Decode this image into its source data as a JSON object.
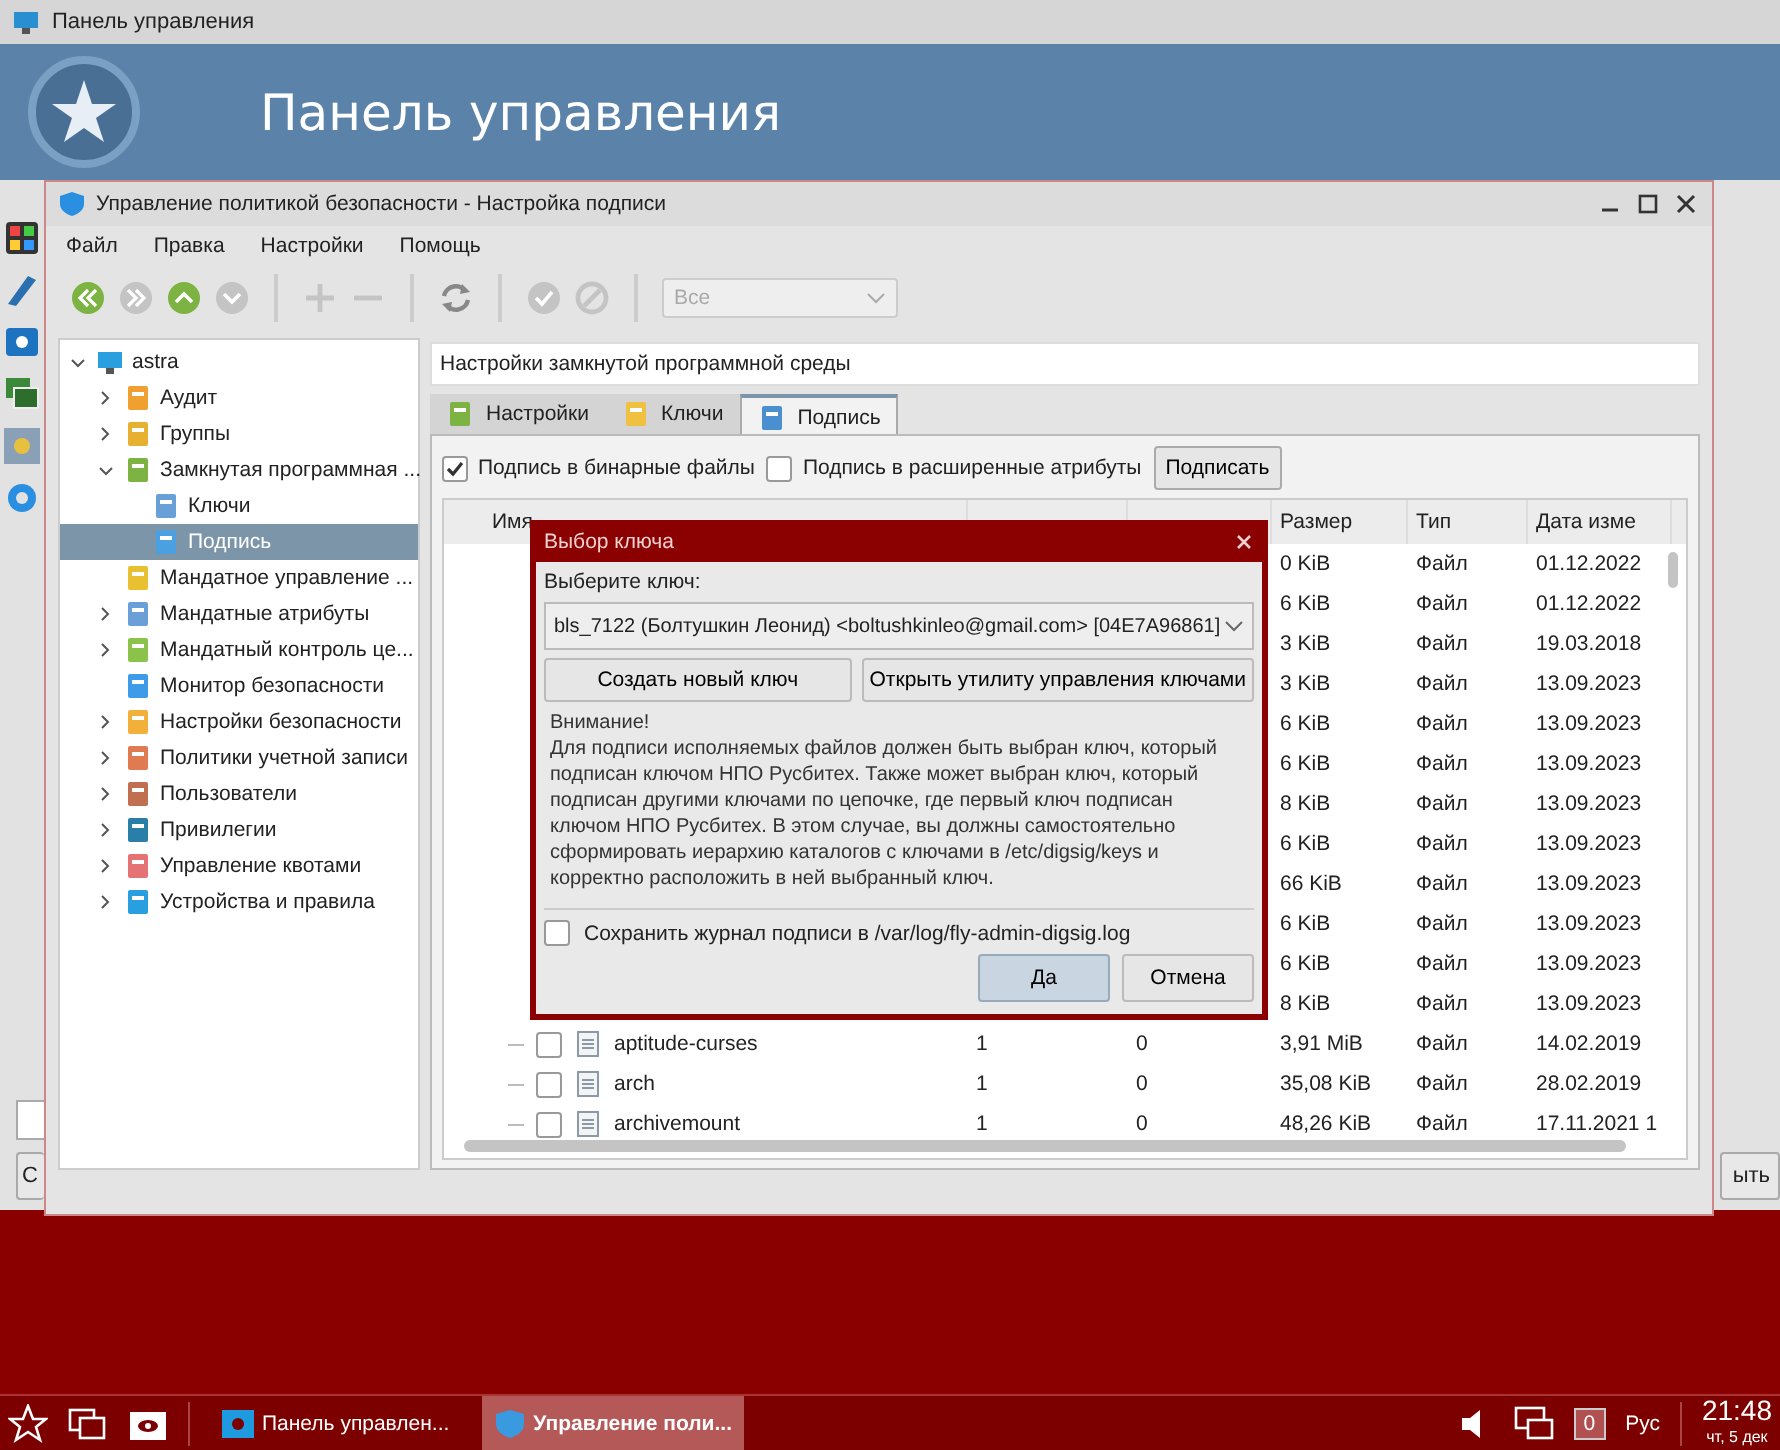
{
  "back_window": {
    "title": "Панель управления",
    "banner": "Панель управления",
    "left_button": "С",
    "right_button": "ыть"
  },
  "window": {
    "title": "Управление политикой безопасности - Настройка подписи"
  },
  "menu": [
    "Файл",
    "Правка",
    "Настройки",
    "Помощь"
  ],
  "toolbar": [
    {
      "kind": "back",
      "disabled": false
    },
    {
      "kind": "forward",
      "disabled": true
    },
    {
      "kind": "up",
      "disabled": false
    },
    {
      "kind": "down",
      "disabled": true
    },
    {
      "kind": "separator"
    },
    {
      "kind": "add",
      "disabled": true
    },
    {
      "kind": "remove",
      "disabled": true
    },
    {
      "kind": "separator"
    },
    {
      "kind": "refresh",
      "disabled": false
    },
    {
      "kind": "separator"
    },
    {
      "kind": "apply",
      "disabled": true
    },
    {
      "kind": "cancel",
      "disabled": true
    },
    {
      "kind": "separator"
    }
  ],
  "filter": {
    "value": "Все",
    "disabled": true
  },
  "tree": [
    {
      "label": "astra",
      "expanded": true,
      "selected": false,
      "children": [
        {
          "label": "Аудит",
          "expanded": false,
          "selected": false
        },
        {
          "label": "Группы",
          "expanded": false,
          "selected": false
        },
        {
          "label": "Замкнутая программная ...",
          "expanded": true,
          "selected": false,
          "children": [
            {
              "label": "Ключи",
              "selected": false
            },
            {
              "label": "Подпись",
              "selected": true
            }
          ]
        },
        {
          "label": "Мандатное управление ...",
          "selected": false
        },
        {
          "label": "Мандатные атрибуты",
          "expanded": false,
          "selected": false
        },
        {
          "label": "Мандатный контроль це...",
          "expanded": false,
          "selected": false
        },
        {
          "label": "Монитор безопасности",
          "selected": false
        },
        {
          "label": "Настройки безопасности",
          "expanded": false,
          "selected": false
        },
        {
          "label": "Политики учетной записи",
          "expanded": false,
          "selected": false
        },
        {
          "label": "Пользователи",
          "expanded": false,
          "selected": false
        },
        {
          "label": "Привилегии",
          "expanded": false,
          "selected": false
        },
        {
          "label": "Управление квотами",
          "expanded": false,
          "selected": false
        },
        {
          "label": "Устройства и правила",
          "expanded": false,
          "selected": false
        }
      ]
    }
  ],
  "section_title": "Настройки замкнутой программной среды",
  "tabs": [
    {
      "label": "Настройки",
      "selected": false
    },
    {
      "label": "Ключи",
      "selected": false
    },
    {
      "label": "Подпись",
      "selected": true
    }
  ],
  "options": [
    {
      "label": "Подпись в бинарные файлы",
      "checked": true
    },
    {
      "label": "Подпись в расширенные атрибуты",
      "checked": false
    }
  ],
  "sign_button": "Подписать",
  "table": {
    "columns": [
      "Имя",
      "Размер",
      "Тип",
      "Дата изме"
    ],
    "rows": [
      {
        "kind": "covered",
        "size": "0 KiB",
        "type": "Файл",
        "date": "01.12.2022"
      },
      {
        "kind": "covered",
        "size": "6 KiB",
        "type": "Файл",
        "date": "01.12.2022"
      },
      {
        "kind": "covered",
        "size": "3 KiB",
        "type": "Файл",
        "date": "19.03.2018"
      },
      {
        "kind": "covered",
        "size": "3 KiB",
        "type": "Файл",
        "date": "13.09.2023"
      },
      {
        "kind": "covered",
        "size": "6 KiB",
        "type": "Файл",
        "date": "13.09.2023"
      },
      {
        "kind": "covered",
        "size": "6 KiB",
        "type": "Файл",
        "date": "13.09.2023"
      },
      {
        "kind": "covered",
        "size": "8 KiB",
        "type": "Файл",
        "date": "13.09.2023"
      },
      {
        "kind": "covered",
        "size": "6 KiB",
        "type": "Файл",
        "date": "13.09.2023"
      },
      {
        "kind": "covered",
        "size": "66 KiB",
        "type": "Файл",
        "date": "13.09.2023"
      },
      {
        "kind": "covered",
        "size": "6 KiB",
        "type": "Файл",
        "date": "13.09.2023"
      },
      {
        "kind": "covered",
        "size": "6 KiB",
        "type": "Файл",
        "date": "13.09.2023"
      },
      {
        "kind": "covered",
        "size": "8 KiB",
        "type": "Файл",
        "date": "13.09.2023"
      },
      {
        "kind": "file",
        "name": "aptitude-curses",
        "checked": false,
        "signatures": "1",
        "extended": "0",
        "size": "3,91 MiB",
        "type": "Файл",
        "date": "14.02.2019"
      },
      {
        "kind": "file",
        "name": "arch",
        "checked": false,
        "signatures": "1",
        "extended": "0",
        "size": "35,08 KiB",
        "type": "Файл",
        "date": "28.02.2019"
      },
      {
        "kind": "file",
        "name": "archivemount",
        "checked": false,
        "signatures": "1",
        "extended": "0",
        "size": "48,26 KiB",
        "type": "Файл",
        "date": "17.11.2021 1"
      }
    ]
  },
  "dialog": {
    "title": "Выбор ключа",
    "key_label": "Выберите ключ:",
    "key": "bls_7122 (Болтушкин Леонид) <boltushkinleo@gmail.com> [04E7A96861]",
    "create_button": "Создать новый ключ",
    "open_button": "Открыть утилиту управления ключами",
    "warning_title": "Внимание!",
    "warning_text": "Для подписи исполняемых файлов должен быть выбран ключ, который подписан ключом НПО Русбитех. Также может выбран ключ, который подписан другими ключами по цепочке, где первый ключ подписан ключом НПО Русбитех. В этом случае, вы должны самостоятельно сформировать иерархию каталогов с ключами в /etc/digsig/keys и корректно расположить в ней выбранный ключ.",
    "log_option": {
      "label": "Сохранить журнал подписи в  /var/log/fly-admin-digsig.log",
      "checked": false
    },
    "ok_button": "Да",
    "cancel_button": "Отмена"
  },
  "taskbar": {
    "tasks": [
      {
        "label": "Панель управлен...",
        "selected": false
      },
      {
        "label": "Управление поли...",
        "selected": true
      }
    ],
    "keyboard_layout": "Рус",
    "notifications": "0",
    "time": "21:48",
    "date": "чт, 5 дек"
  }
}
